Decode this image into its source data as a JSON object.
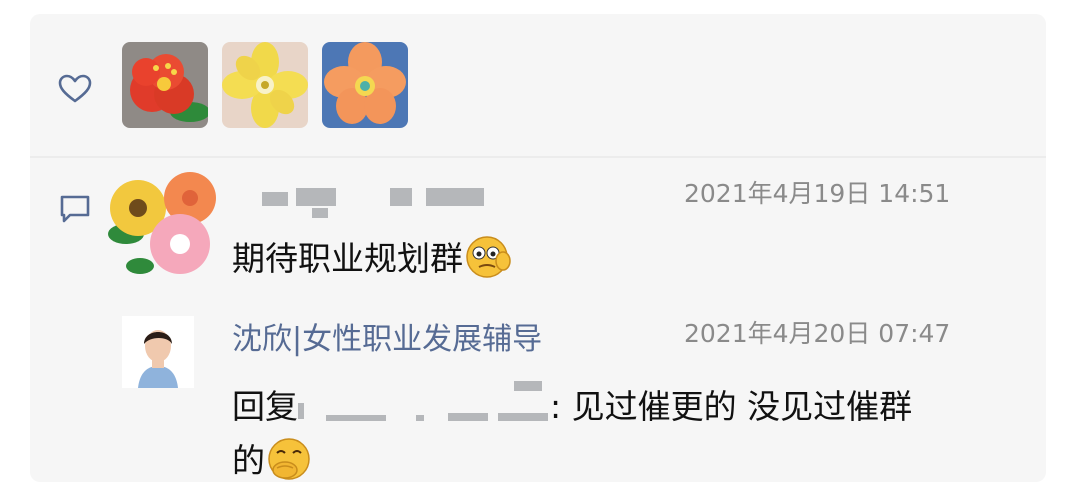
{
  "icons": {
    "like": "heart-outline-icon",
    "comment": "comment-icon",
    "emoji_comment": "face-emoji-icon",
    "emoji_reply": "thinking-face-emoji-icon"
  },
  "colors": {
    "background": "#f6f6f6",
    "name_link": "#566b94",
    "timestamp": "#8a8a8a",
    "text": "#111111"
  },
  "comment": {
    "timestamp": "2021年4月19日 14:51",
    "text": "期待职业规划群"
  },
  "reply": {
    "author": "沈欣|女性职业发展辅导",
    "timestamp": "2021年4月20日 07:47",
    "prefix": "回复",
    "text_after_name": ": 见过催更的 没见过催群",
    "text_line2": "的"
  }
}
